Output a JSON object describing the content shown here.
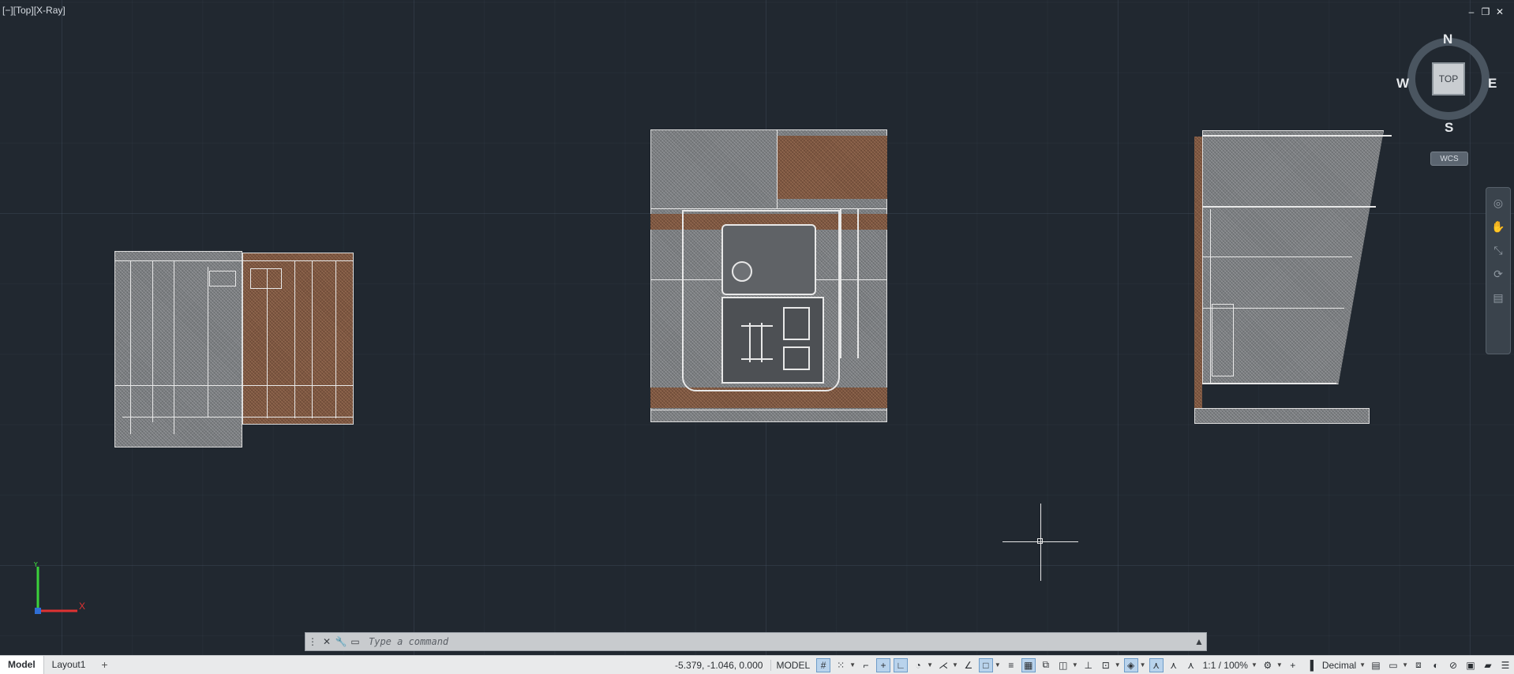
{
  "viewport": {
    "label": "[−][Top][X-Ray]",
    "window_controls": [
      "–",
      "❐",
      "✕"
    ]
  },
  "viewcube": {
    "north": "N",
    "south": "S",
    "east": "E",
    "west": "W",
    "face": "TOP",
    "coordinate_system": "WCS"
  },
  "ucs": {
    "x_label": "X",
    "y_label": "Y"
  },
  "command_line": {
    "placeholder": "Type a command"
  },
  "layout_tabs": [
    {
      "label": "Model",
      "active": true
    },
    {
      "label": "Layout1",
      "active": false
    }
  ],
  "add_tab_label": "+",
  "status_bar": {
    "coordinates": "-5.379, -1.046, 0.000",
    "space": "MODEL",
    "annotation_scale": "1:1 / 100%",
    "units": "Decimal",
    "icons": [
      "grid-icon",
      "snap-icon",
      "infer-icon",
      "ortho-icon",
      "polar-icon",
      "isodraft-icon",
      "object-track-icon",
      "object-snap-icon",
      "lineweight-icon",
      "transparency-icon",
      "selection-cycling-icon",
      "3d-osnap-icon",
      "gizmo-icon",
      "annotation-monitor-icon",
      "auto-scale-icon",
      "annotation-visibility-icon",
      "workspace-icon",
      "plus-icon",
      "units-icon",
      "quick-properties-icon",
      "lock-ui-icon",
      "isolate-icon",
      "hardware-accel-icon",
      "clean-screen-icon",
      "customize-icon"
    ]
  }
}
